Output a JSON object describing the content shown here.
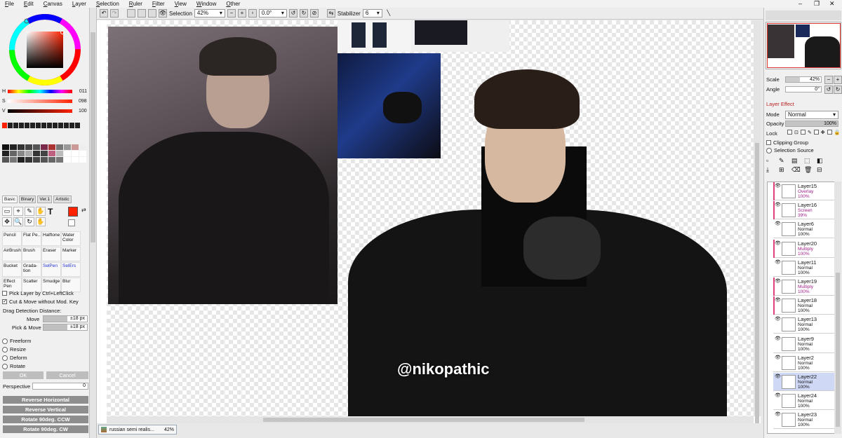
{
  "menu": [
    "File",
    "Edit",
    "Canvas",
    "Layer",
    "Selection",
    "Ruler",
    "Filter",
    "View",
    "Window",
    "Other"
  ],
  "toolbar": {
    "selection_label": "Selection",
    "zoom": "42%",
    "angle": "0.0°",
    "stabilizer_label": "Stabilizer",
    "stabilizer_value": "6"
  },
  "color": {
    "h_label": "H",
    "h_value": "011",
    "s_label": "S",
    "s_value": "098",
    "v_label": "V",
    "v_value": "100",
    "current": "#ff2200"
  },
  "palette": [
    "#111",
    "#222",
    "#333",
    "#444",
    "#555",
    "#7a2a4a",
    "#a33",
    "#777",
    "#999",
    "#c99",
    "#eee",
    "#222",
    "#666",
    "#888",
    "#aaa",
    "#333",
    "#444",
    "#c06080",
    "#bbb",
    "#fff",
    "#fff",
    "#fff",
    "#555",
    "#777",
    "#222",
    "#333",
    "#444",
    "#555",
    "#666",
    "#777",
    "#fff",
    "#fff",
    "#fff"
  ],
  "tool_tabs": [
    "Basic",
    "Binary",
    "Ver.1",
    "Artistic"
  ],
  "tool_icons": [
    "▭",
    "⌖",
    "✎",
    "✋",
    "✥",
    "🔍",
    "↻",
    "✋"
  ],
  "text_tool": "T",
  "brushes": [
    {
      "name": "Pencil"
    },
    {
      "name": "Flat Pe..."
    },
    {
      "name": "Halftone"
    },
    {
      "name": "Water Color"
    },
    {
      "name": "AirBrush"
    },
    {
      "name": "Brush"
    },
    {
      "name": "Eraser"
    },
    {
      "name": "Marker"
    },
    {
      "name": "Bucket"
    },
    {
      "name": "Grada- tion"
    },
    {
      "name": "SelPen"
    },
    {
      "name": "SelErs"
    },
    {
      "name": "Effect Pen"
    },
    {
      "name": "Scatter"
    },
    {
      "name": "Smudge"
    },
    {
      "name": "Blur"
    }
  ],
  "options": {
    "pick_layer": "Pick Layer by Ctrl+LeftClick",
    "cut_move": "Cut & Move without Mod. Key",
    "drag_label": "Drag Detection Distance:",
    "move_label": "Move",
    "move_value": "±18 px",
    "pick_move_label": "Pick & Move",
    "pick_move_value": "±18 px",
    "transform": [
      "Freeform",
      "Resize",
      "Deform",
      "Rotate"
    ],
    "ok": "OK",
    "cancel": "Cancel",
    "perspective_label": "Perspective",
    "perspective_value": "0",
    "reverse_h": "Reverse Horizontal",
    "reverse_v": "Reverse Vertical",
    "rot_ccw": "Rotate 90deg. CCW",
    "rot_cw": "Rotate 90deg. CW"
  },
  "canvas": {
    "watermark": "@nikopathic",
    "doc_tab": "russian semi realis...",
    "doc_zoom": "42%"
  },
  "nav": {
    "scale_label": "Scale",
    "scale_value": "42%",
    "angle_label": "Angle",
    "angle_value": "0°"
  },
  "layer_panel": {
    "effect_label": "Layer Effect",
    "mode_label": "Mode",
    "mode_value": "Normal",
    "opacity_label": "Opacity",
    "opacity_value": "100%",
    "lock_label": "Lock",
    "clipping": "Clipping Group",
    "sel_source": "Selection Source",
    "layers": [
      {
        "name": "Layer15",
        "mode": "Overlay",
        "opacity": "100%",
        "tag": "#e0407a"
      },
      {
        "name": "Layer16",
        "mode": "Screen",
        "opacity": "39%",
        "tag": "#e0407a"
      },
      {
        "name": "Layer6",
        "mode": "Normal",
        "opacity": "100%",
        "tag": ""
      },
      {
        "name": "Layer20",
        "mode": "Multiply",
        "opacity": "100%",
        "tag": "#e0407a"
      },
      {
        "name": "Layer11",
        "mode": "Normal",
        "opacity": "100%",
        "tag": ""
      },
      {
        "name": "Layer19",
        "mode": "Multiply",
        "opacity": "100%",
        "tag": "#e0407a"
      },
      {
        "name": "Layer18",
        "mode": "Normal",
        "opacity": "100%",
        "tag": "#e0407a"
      },
      {
        "name": "Layer13",
        "mode": "Normal",
        "opacity": "100%",
        "tag": ""
      },
      {
        "name": "Layer9",
        "mode": "Normal",
        "opacity": "100%",
        "tag": ""
      },
      {
        "name": "Layer2",
        "mode": "Normal",
        "opacity": "100%",
        "tag": ""
      },
      {
        "name": "Layer22",
        "mode": "Normal",
        "opacity": "100%",
        "tag": "",
        "selected": true
      },
      {
        "name": "Layer24",
        "mode": "Normal",
        "opacity": "100%",
        "tag": ""
      },
      {
        "name": "Layer23",
        "mode": "Normal",
        "opacity": "100%",
        "tag": ""
      }
    ]
  }
}
